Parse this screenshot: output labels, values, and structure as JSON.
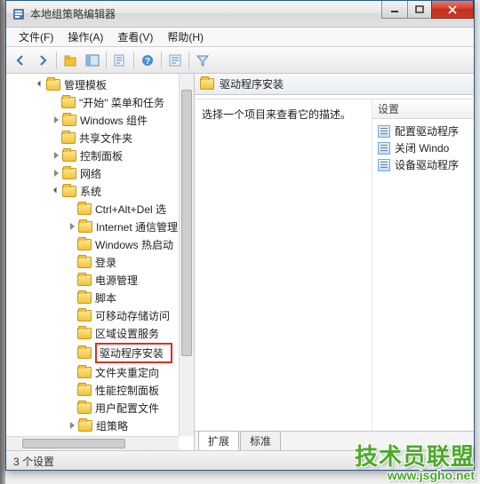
{
  "window": {
    "title": "本地组策略编辑器"
  },
  "menu": {
    "file": "文件(F)",
    "action": "操作(A)",
    "view": "查看(V)",
    "help": "帮助(H)"
  },
  "tree": {
    "root": "管理模板",
    "items": [
      "\"开始\" 菜单和任务",
      "Windows 组件",
      "共享文件夹",
      "控制面板",
      "网络",
      "系统"
    ],
    "system_children": [
      "Ctrl+Alt+Del 选",
      "Internet 通信管理",
      "Windows 热启动",
      "登录",
      "电源管理",
      "脚本",
      "可移动存储访问",
      "区域设置服务",
      "驱动程序安装",
      "文件夹重定向",
      "性能控制面板",
      "用户配置文件",
      "组策略"
    ]
  },
  "right": {
    "header": "驱动程序安装",
    "description": "选择一个项目来查看它的描述。",
    "settings_label": "设置",
    "settings": [
      "配置驱动程序",
      "关闭 Windo",
      "设备驱动程序"
    ]
  },
  "tabs": {
    "extended": "扩展",
    "standard": "标准"
  },
  "status": "3 个设置",
  "watermark": {
    "main": "技术员联盟",
    "sub": "www.jsgho.net"
  }
}
